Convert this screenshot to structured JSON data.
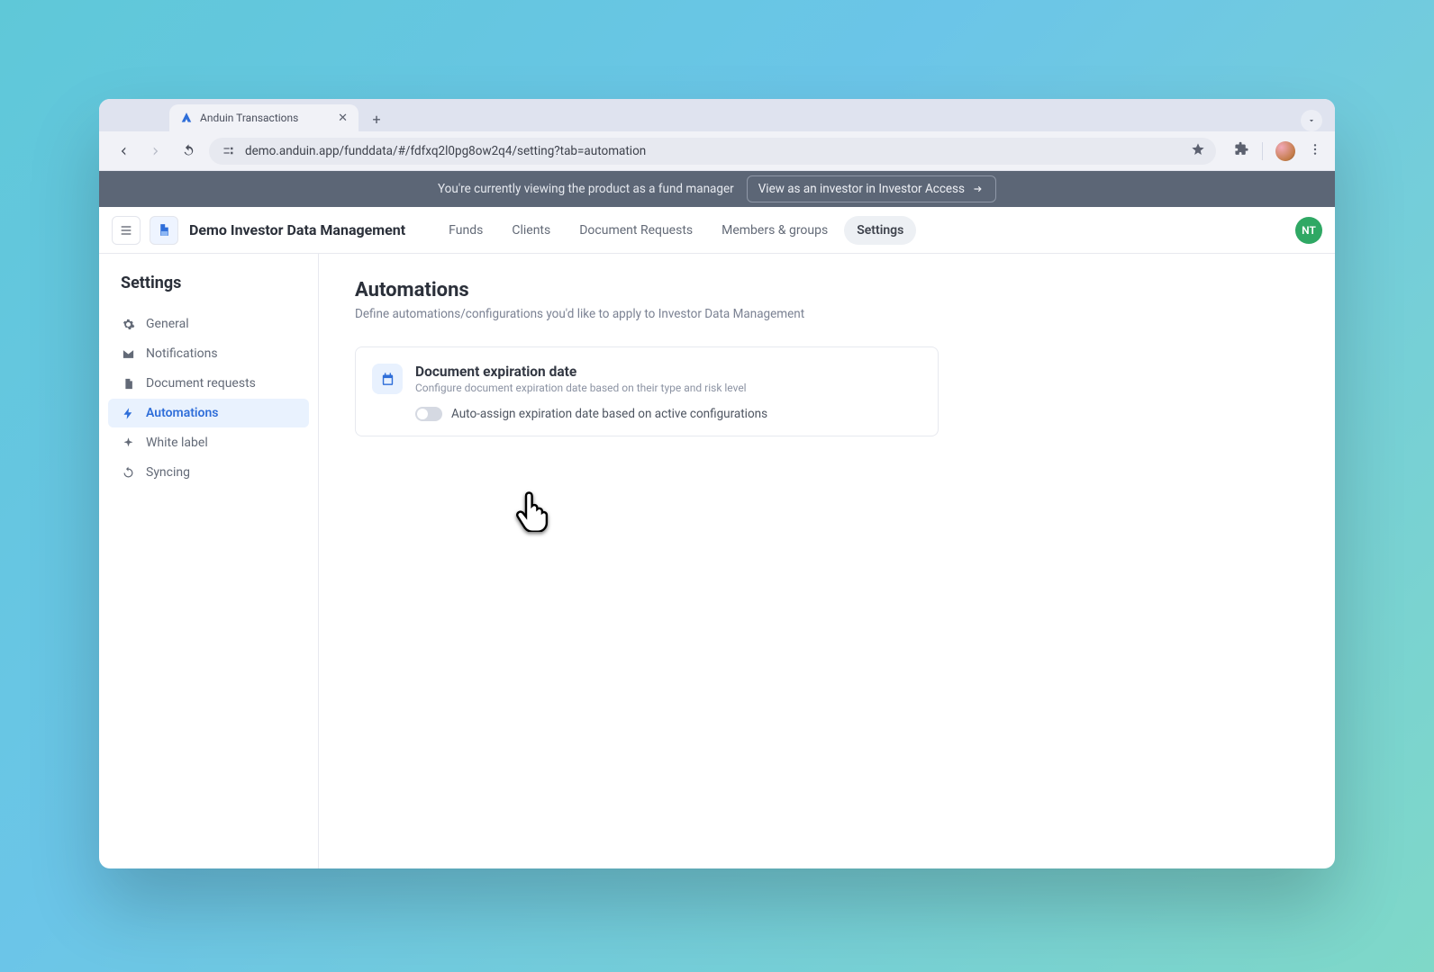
{
  "browser": {
    "tab_title": "Anduin Transactions",
    "url": "demo.anduin.app/funddata/#/fdfxq2l0pg8ow2q4/setting?tab=automation"
  },
  "notice": {
    "text": "You're currently viewing the product as a fund manager",
    "link": "View as an investor in Investor Access"
  },
  "app": {
    "title": "Demo Investor Data Management",
    "avatar_initials": "NT"
  },
  "topnav": {
    "items": [
      "Funds",
      "Clients",
      "Document Requests",
      "Members & groups",
      "Settings"
    ],
    "active_index": 4
  },
  "sidebar": {
    "title": "Settings",
    "items": [
      {
        "label": "General",
        "icon": "gear"
      },
      {
        "label": "Notifications",
        "icon": "mail"
      },
      {
        "label": "Document requests",
        "icon": "doc"
      },
      {
        "label": "Automations",
        "icon": "bolt"
      },
      {
        "label": "White label",
        "icon": "spark"
      },
      {
        "label": "Syncing",
        "icon": "sync"
      }
    ],
    "active_index": 3
  },
  "main": {
    "heading": "Automations",
    "subheading": "Define automations/configurations you'd like to apply to Investor Data Management",
    "card": {
      "title": "Document expiration date",
      "desc": "Configure document expiration date based on their type and risk level",
      "toggle_label": "Auto-assign expiration date based on active configurations",
      "toggle_on": false
    }
  }
}
